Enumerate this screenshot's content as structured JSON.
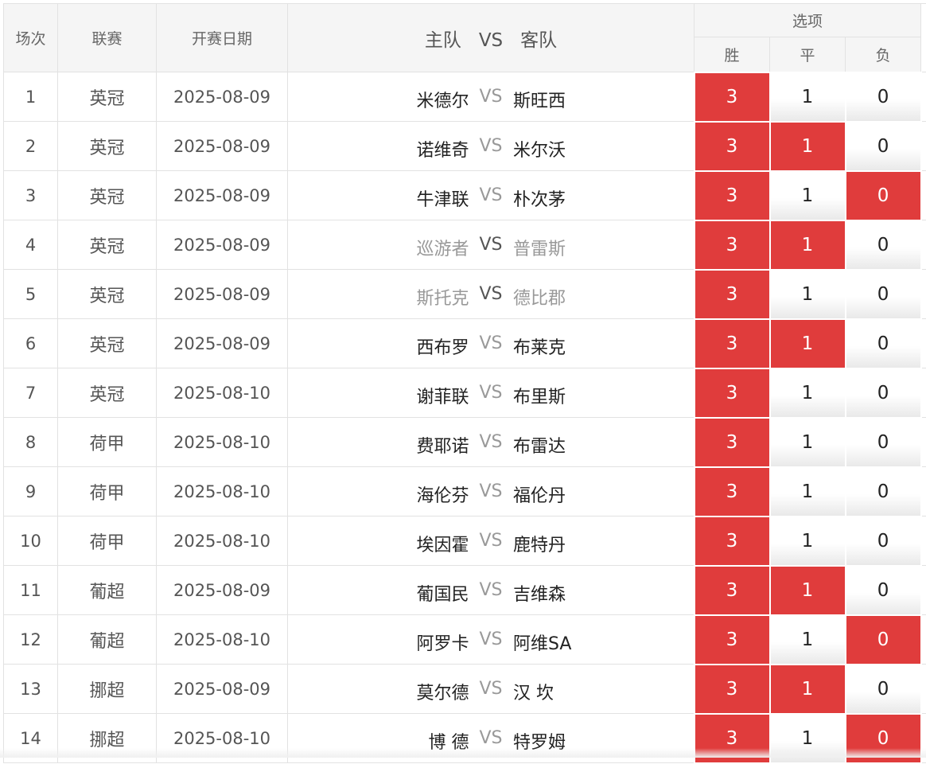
{
  "headers": {
    "idx": "场次",
    "league": "联赛",
    "date": "开赛日期",
    "home": "主队",
    "vs": "VS",
    "away": "客队",
    "options": "选项",
    "win": "胜",
    "draw": "平",
    "lose": "负"
  },
  "rows": [
    {
      "idx": "1",
      "league": "英冠",
      "date": "2025-08-09",
      "home": "米德尔",
      "away": "斯旺西",
      "dim": false,
      "win": "3",
      "draw": "1",
      "lose": "0",
      "sel": [
        true,
        false,
        false
      ]
    },
    {
      "idx": "2",
      "league": "英冠",
      "date": "2025-08-09",
      "home": "诺维奇",
      "away": "米尔沃",
      "dim": false,
      "win": "3",
      "draw": "1",
      "lose": "0",
      "sel": [
        true,
        true,
        false
      ]
    },
    {
      "idx": "3",
      "league": "英冠",
      "date": "2025-08-09",
      "home": "牛津联",
      "away": "朴次茅",
      "dim": false,
      "win": "3",
      "draw": "1",
      "lose": "0",
      "sel": [
        true,
        false,
        true
      ]
    },
    {
      "idx": "4",
      "league": "英冠",
      "date": "2025-08-09",
      "home": "巡游者",
      "away": "普雷斯",
      "dim": true,
      "win": "3",
      "draw": "1",
      "lose": "0",
      "sel": [
        true,
        true,
        false
      ]
    },
    {
      "idx": "5",
      "league": "英冠",
      "date": "2025-08-09",
      "home": "斯托克",
      "away": "德比郡",
      "dim": true,
      "win": "3",
      "draw": "1",
      "lose": "0",
      "sel": [
        true,
        false,
        false
      ]
    },
    {
      "idx": "6",
      "league": "英冠",
      "date": "2025-08-09",
      "home": "西布罗",
      "away": "布莱克",
      "dim": false,
      "win": "3",
      "draw": "1",
      "lose": "0",
      "sel": [
        true,
        true,
        false
      ]
    },
    {
      "idx": "7",
      "league": "英冠",
      "date": "2025-08-10",
      "home": "谢菲联",
      "away": "布里斯",
      "dim": false,
      "win": "3",
      "draw": "1",
      "lose": "0",
      "sel": [
        true,
        false,
        false
      ]
    },
    {
      "idx": "8",
      "league": "荷甲",
      "date": "2025-08-10",
      "home": "费耶诺",
      "away": "布雷达",
      "dim": false,
      "win": "3",
      "draw": "1",
      "lose": "0",
      "sel": [
        true,
        false,
        false
      ]
    },
    {
      "idx": "9",
      "league": "荷甲",
      "date": "2025-08-10",
      "home": "海伦芬",
      "away": "福伦丹",
      "dim": false,
      "win": "3",
      "draw": "1",
      "lose": "0",
      "sel": [
        true,
        false,
        false
      ]
    },
    {
      "idx": "10",
      "league": "荷甲",
      "date": "2025-08-10",
      "home": "埃因霍",
      "away": "鹿特丹",
      "dim": false,
      "win": "3",
      "draw": "1",
      "lose": "0",
      "sel": [
        true,
        false,
        false
      ]
    },
    {
      "idx": "11",
      "league": "葡超",
      "date": "2025-08-09",
      "home": "葡国民",
      "away": "吉维森",
      "dim": false,
      "win": "3",
      "draw": "1",
      "lose": "0",
      "sel": [
        true,
        true,
        false
      ]
    },
    {
      "idx": "12",
      "league": "葡超",
      "date": "2025-08-10",
      "home": "阿罗卡",
      "away": "阿维SA",
      "dim": false,
      "win": "3",
      "draw": "1",
      "lose": "0",
      "sel": [
        true,
        false,
        true
      ]
    },
    {
      "idx": "13",
      "league": "挪超",
      "date": "2025-08-09",
      "home": "莫尔德",
      "away": "汉 坎",
      "dim": false,
      "win": "3",
      "draw": "1",
      "lose": "0",
      "sel": [
        true,
        true,
        false
      ]
    },
    {
      "idx": "14",
      "league": "挪超",
      "date": "2025-08-10",
      "home": "博 德",
      "away": "特罗姆",
      "dim": false,
      "win": "3",
      "draw": "1",
      "lose": "0",
      "sel": [
        true,
        false,
        true
      ]
    }
  ],
  "colors": {
    "selected": "#e03c3c",
    "header_bg": "#f5f5f5",
    "border": "#e2e2e2"
  }
}
